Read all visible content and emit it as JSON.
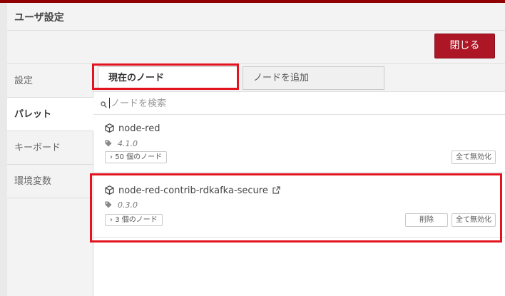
{
  "dialog": {
    "title": "ユーザ設定",
    "close_label": "閉じる"
  },
  "sidebar": {
    "items": [
      {
        "label": "設定",
        "active": false
      },
      {
        "label": "パレット",
        "active": true
      },
      {
        "label": "キーボード",
        "active": false
      },
      {
        "label": "環境変数",
        "active": false
      }
    ]
  },
  "tabs": [
    {
      "label": "現在のノード",
      "active": true
    },
    {
      "label": "ノードを追加",
      "active": false
    }
  ],
  "search": {
    "placeholder": "ノードを検索",
    "value": ""
  },
  "nodes": [
    {
      "name": "node-red",
      "version": "4.1.0",
      "count_label": "50 個のノード",
      "disable_all_label": "全て無効化",
      "has_link": false
    },
    {
      "name": "node-red-contrib-rdkafka-secure",
      "version": "0.3.0",
      "count_label": "3 個のノード",
      "delete_label": "削除",
      "disable_all_label": "全て無効化",
      "has_link": true
    }
  ],
  "icons": {
    "search": "search-icon",
    "module": "cube-icon",
    "version": "tag-icon",
    "expand": "chevron-right-icon",
    "external_link": "external-link-icon"
  },
  "colors": {
    "accent": "#ad1625",
    "highlight_annotation": "#e3141f",
    "topbar": "#8f0000"
  }
}
